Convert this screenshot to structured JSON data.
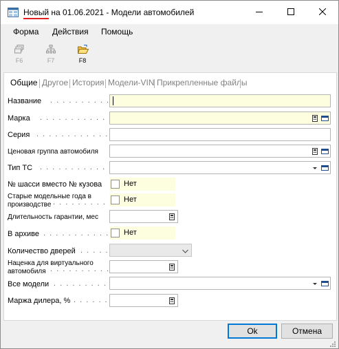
{
  "window": {
    "title_new": "Новый",
    "title_rest": " на 01.06.2021 - Модели автомобилей"
  },
  "menu": [
    "Форма",
    "Действия",
    "Помощь"
  ],
  "toolbar": [
    {
      "label": "F6",
      "icon": "tree-icon",
      "enabled": false
    },
    {
      "label": "F7",
      "icon": "hierarchy-icon",
      "enabled": false
    },
    {
      "label": "F8",
      "icon": "open-folder-icon",
      "enabled": true
    }
  ],
  "tabs": [
    "Общие",
    "Другое",
    "История",
    "Модели-VIN",
    "Прикрепленные файлы"
  ],
  "form": {
    "name_label": "Название",
    "brand_label": "Марка",
    "series_label": "Серия",
    "price_group_label": "Ценовая группа автомобиля",
    "vehicle_type_label": "Тип ТС",
    "chassis_label": "№ шасси вместо № кузова",
    "chassis_value": "Нет",
    "old_years_label_1": "Старые модельные года в",
    "old_years_label_2": "производстве",
    "old_years_value": "Нет",
    "warranty_label": "Длительность гарантии, мес",
    "archive_label": "В архиве",
    "archive_value": "Нет",
    "doors_label": "Количество дверей",
    "markup_label_1": "Наценка для виртуального",
    "markup_label_2": "автомобиля",
    "all_models_label": "Все модели",
    "dealer_margin_label": "Маржа дилера, %"
  },
  "buttons": {
    "ok": "Ok",
    "cancel": "Отмена"
  },
  "colors": {
    "required_field": "#fdfde0",
    "accent": "#0078d7",
    "title_underline": "#e02020"
  }
}
